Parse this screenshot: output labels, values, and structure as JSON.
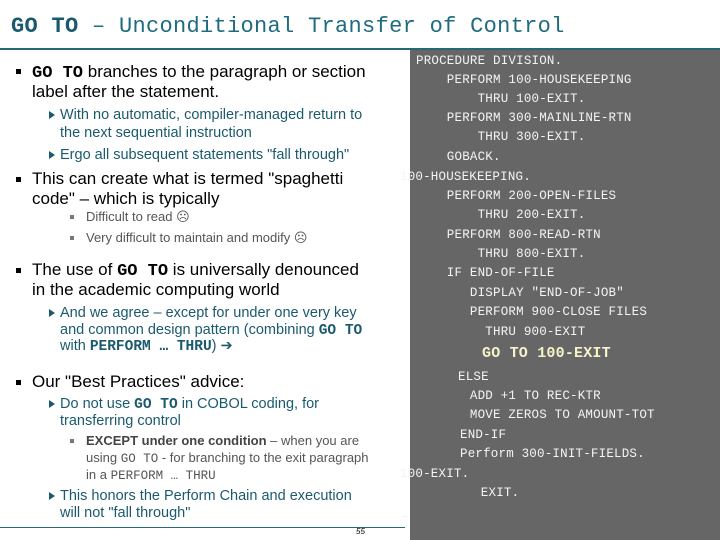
{
  "title": {
    "kw": "GO TO",
    "rest": " – Unconditional Transfer of Control"
  },
  "left": {
    "b1": {
      "kw": "GO TO",
      "line1_rest": " branches to the paragraph or section",
      "line2": "label after the statement."
    },
    "b1_sub1": {
      "line1": "With no automatic, compiler-managed return to",
      "line2": "the next sequential instruction"
    },
    "b1_sub2": "Ergo all subsequent statements \"fall through\"",
    "b2": {
      "line1": "This can create what is termed \"spaghetti",
      "line2": "code\" – which is typically"
    },
    "b2_sub1": "Difficult to read ☹",
    "b2_sub2": "Very difficult to maintain and modify ☹",
    "b3": {
      "pre": "The use of ",
      "kw": "GO TO",
      "post": " is universally denounced",
      "line2": "in the academic computing world"
    },
    "b3_sub1": {
      "line1": "And we agree – except for under one very key",
      "line2_pre": "and common design pattern (combining ",
      "line2_kw": "GO TO",
      "line3_pre": "with ",
      "line3_kw": "PERFORM … THRU",
      "line3_post": ") ➔"
    },
    "b4": "Our \"Best Practices\" advice:",
    "b4_sub1": {
      "pre": "Do not use ",
      "kw": "GO TO",
      "post": " in COBOL coding, for",
      "line2": "transferring control"
    },
    "b4_sub1_sub": {
      "bold": "EXCEPT under one condition",
      "line1_rest": " – when you are",
      "line2_pre": "using ",
      "line2_kw": "GO TO",
      "line2_post": " - for branching to the exit paragraph",
      "line3_pre": "in a ",
      "line3_kw": "PERFORM … THRU"
    },
    "b4_sub2": {
      "line1": "This honors the Perform Chain and execution",
      "line2": "will not \"fall through\""
    }
  },
  "page_number": "55",
  "code": [
    "PROCEDURE DIVISION.",
    "    PERFORM 100-HOUSEKEEPING",
    "        THRU 100-EXIT.",
    "    PERFORM 300-MAINLINE-RTN",
    "        THRU 300-EXIT.",
    "    GOBACK.",
    "100-HOUSEKEEPING.",
    "    PERFORM 200-OPEN-FILES",
    "        THRU 200-EXIT.",
    "    PERFORM 800-READ-RTN",
    "        THRU 800-EXIT.",
    "    IF END-OF-FILE",
    "       DISPLAY \"END-OF-JOB\"",
    "       PERFORM 900-CLOSE FILES",
    "         THRU 900-EXIT",
    "GO TO 100-EXIT",
    "ELSE",
    "       ADD +1 TO REC-KTR",
    "       MOVE ZEROS TO AMOUNT-TOT",
    "END-IF",
    "Perform 300-INIT-FIELDS.",
    "100-EXIT.",
    "    EXIT.",
    "…"
  ]
}
